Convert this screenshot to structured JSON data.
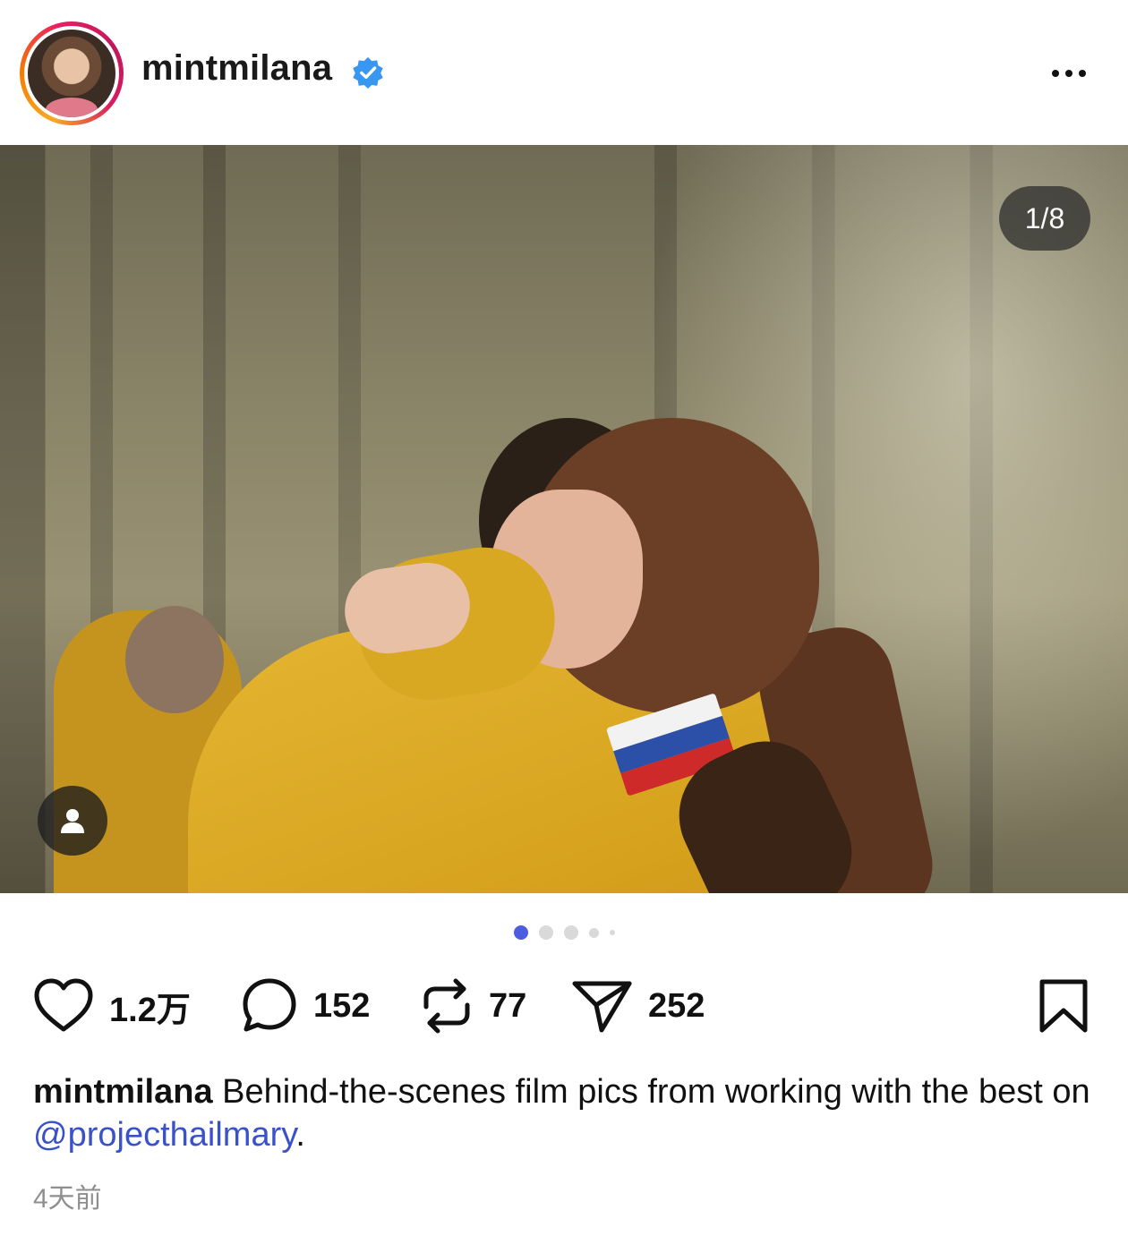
{
  "post": {
    "username": "mintmilana",
    "image_counter": "1/8",
    "carousel_dots": 5,
    "carousel_active_index": 0,
    "stats": {
      "likes": "1.2万",
      "comments": "152",
      "reposts": "77",
      "shares": "252"
    },
    "caption": {
      "username": "mintmilana",
      "text": "Behind-the-scenes film pics from working with the best on",
      "mention": "@projecthailmary",
      "tail": "."
    },
    "time_ago": "4天前"
  },
  "icons": {
    "verified": "verified-badge-icon",
    "more": "more-dots-icon",
    "tag": "person-tag-icon",
    "like": "heart-icon",
    "comment": "comment-bubble-icon",
    "repost": "repost-icon",
    "share": "send-icon",
    "save": "bookmark-icon"
  },
  "colors": {
    "verified": "#3897f0",
    "mention": "#3a52c9",
    "active_dot": "#4c5ddf",
    "muted_text": "#8e8e8e"
  }
}
